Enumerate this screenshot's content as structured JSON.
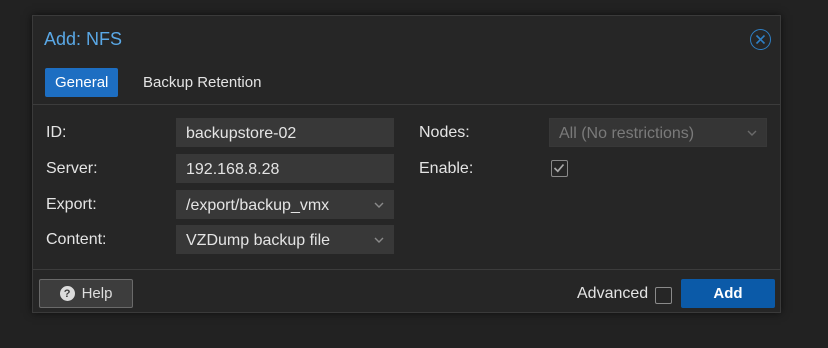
{
  "dialog": {
    "title": "Add: NFS",
    "close_icon": "close-circle-icon"
  },
  "tabs": [
    {
      "label": "General",
      "active": true
    },
    {
      "label": "Backup Retention",
      "active": false
    }
  ],
  "form": {
    "id": {
      "label": "ID:",
      "value": "backupstore-02"
    },
    "server": {
      "label": "Server:",
      "value": "192.168.8.28"
    },
    "export": {
      "label": "Export:",
      "value": "/export/backup_vmx"
    },
    "content": {
      "label": "Content:",
      "value": "VZDump backup file"
    },
    "nodes": {
      "label": "Nodes:",
      "value": "All (No restrictions)",
      "disabled": true
    },
    "enable": {
      "label": "Enable:",
      "checked": true
    }
  },
  "footer": {
    "help_label": "Help",
    "advanced_label": "Advanced",
    "advanced_checked": false,
    "add_label": "Add"
  },
  "colors": {
    "accent": "#1d6ec2",
    "title": "#5aa8e6",
    "add_button": "#0b5aa8",
    "background": "#262626"
  }
}
